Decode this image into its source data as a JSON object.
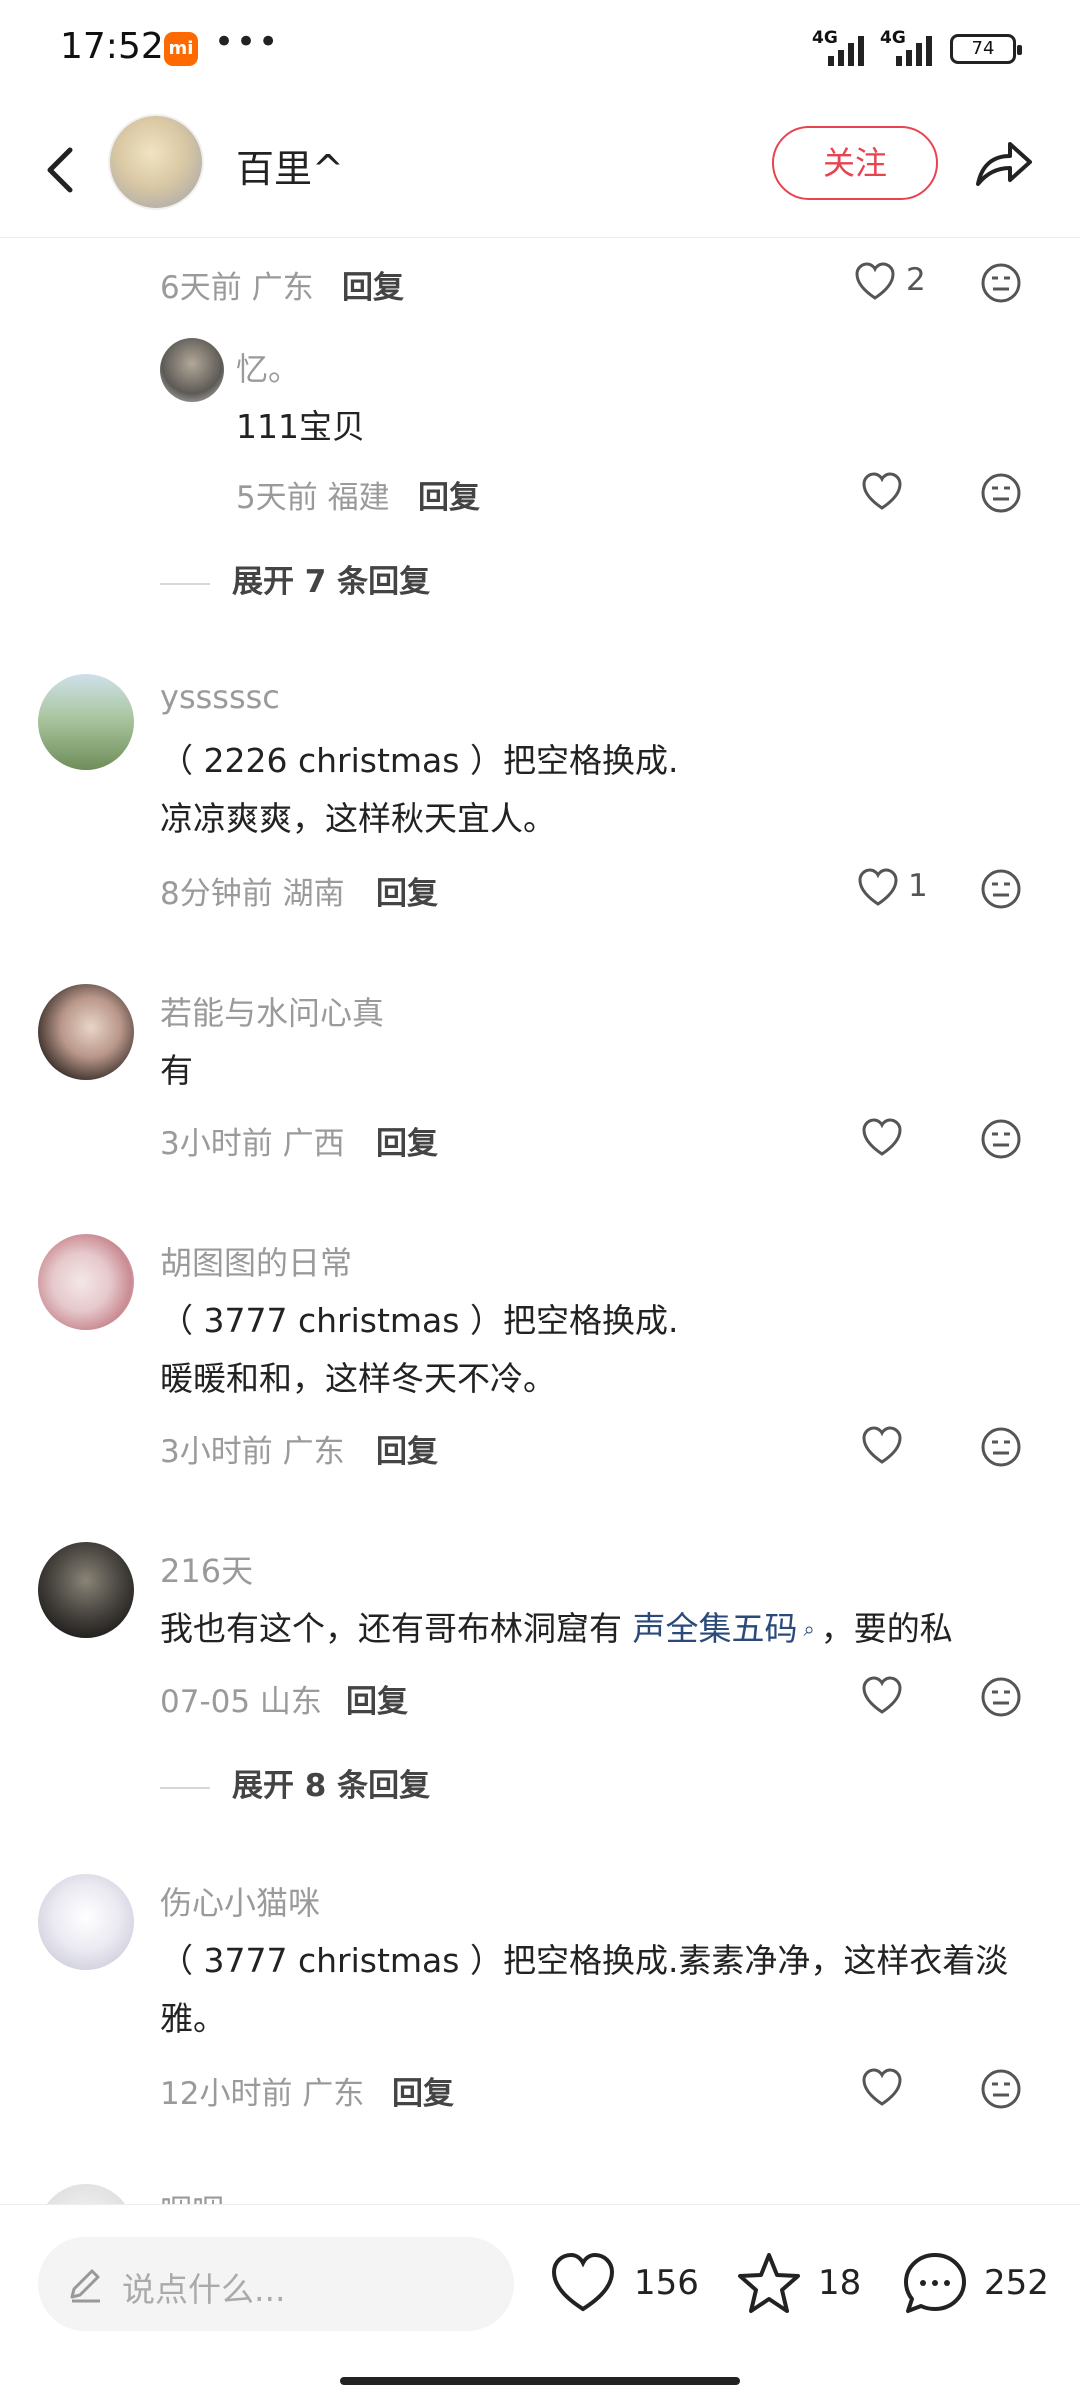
{
  "status_bar": {
    "time": "17:52",
    "mi_badge": "mi",
    "dots": "•••",
    "signal1": "4G",
    "signal2": "4G",
    "battery": "74"
  },
  "header": {
    "author_name": "百里^",
    "follow_label": "关注"
  },
  "comments": {
    "top_meta": {
      "time_loc": "6天前 广东",
      "reply": "回复",
      "likes": "2"
    },
    "sub_reply": {
      "user": "忆。",
      "text": "111宝贝",
      "time_loc": "5天前 福建",
      "reply": "回复"
    },
    "expand1": "展开 7 条回复",
    "c1": {
      "user": "ysssssc",
      "line1": "（ 2226 christmas ）把空格换成.",
      "line2": "凉凉爽爽，这样秋天宜人。",
      "time_loc": "8分钟前 湖南",
      "reply": "回复",
      "likes": "1"
    },
    "c2": {
      "user": "若能与水问心真",
      "line1": "有",
      "time_loc": "3小时前 广西",
      "reply": "回复"
    },
    "c3": {
      "user": "胡图图的日常",
      "line1": "（ 3777 christmas ）把空格换成.",
      "line2": "暖暖和和，这样冬天不冷。",
      "time_loc": "3小时前 广东",
      "reply": "回复"
    },
    "c4": {
      "user": "216天",
      "text_a": "我也有这个，还有哥布林洞窟有 ",
      "text_link": "声全集五码",
      "text_b": "，要的私",
      "time_loc": "07-05 山东",
      "reply": "回复"
    },
    "expand2": "展开 8 条回复",
    "c5": {
      "user": "伤心小猫咪",
      "line1": "（ 3777 christmas ）把空格换成.素素净净，这样衣着淡",
      "line2": "雅。",
      "time_loc": "12小时前 广东",
      "reply": "回复"
    },
    "c6": {
      "user": "咽咽"
    }
  },
  "bottom_bar": {
    "placeholder": "说点什么...",
    "likes": "156",
    "stars": "18",
    "comments": "252"
  },
  "icons": {
    "back": "chevron-left-icon",
    "share": "share-arrow-icon",
    "heart": "heart-outline-icon",
    "dislike": "neutral-face-icon",
    "star": "star-outline-icon",
    "comment": "chat-bubble-icon",
    "pen": "pen-icon"
  },
  "colors": {
    "accent": "#e8434f",
    "link": "#2b4a7a",
    "meta": "#9a9a9a"
  }
}
